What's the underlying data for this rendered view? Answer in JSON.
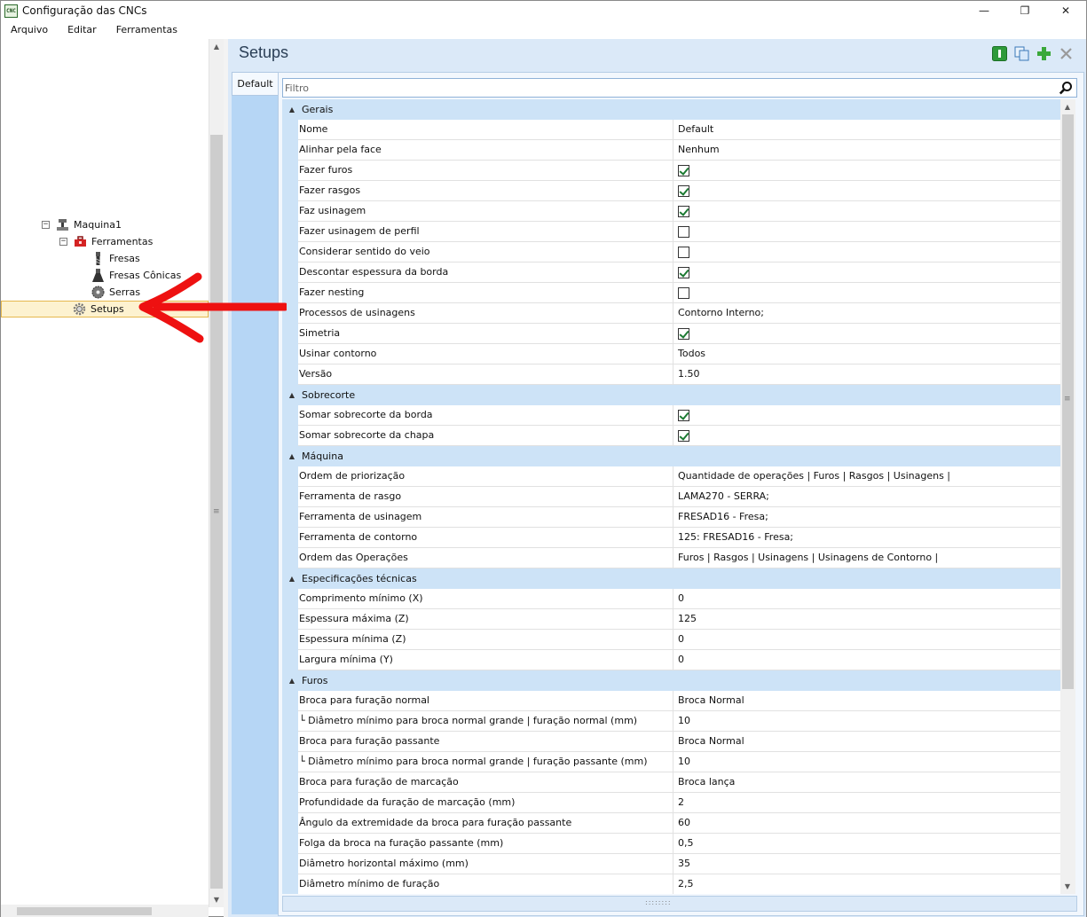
{
  "window": {
    "title": "Configuração das CNCs",
    "app_icon_text": "CNC",
    "min_glyph": "—",
    "max_glyph": "❐",
    "close_glyph": "✕"
  },
  "menu": {
    "items": [
      {
        "label": "Arquivo"
      },
      {
        "label": "Editar"
      },
      {
        "label": "Ferramentas"
      }
    ]
  },
  "tree": {
    "machine": {
      "label": "Maquina1",
      "expander": "−",
      "icon": "machine-icon"
    },
    "tools": {
      "label": "Ferramentas",
      "expander": "−",
      "icon": "toolbox-icon"
    },
    "fresas": {
      "label": "Fresas",
      "icon": "end-mill-icon"
    },
    "fresas_conicas": {
      "label": "Fresas Cônicas",
      "icon": "conical-mill-icon"
    },
    "serras": {
      "label": "Serras",
      "icon": "saw-blade-icon"
    },
    "setups": {
      "label": "Setups",
      "icon": "gear-icon",
      "selected": true
    }
  },
  "panel": {
    "title": "Setups",
    "toolbar": [
      "info-icon",
      "copy-icon",
      "add-icon",
      "delete-icon"
    ],
    "tab": "Default",
    "filter_placeholder": "Filtro",
    "filter_value": "",
    "accent_color": "#cde3f7",
    "selection_color": "#fdf2d0",
    "annotation_arrow_color": "#ee1111"
  },
  "categories": [
    {
      "name": "Gerais",
      "rows": [
        {
          "name": "Nome",
          "type": "text",
          "value": "Default"
        },
        {
          "name": "Alinhar pela face",
          "type": "text",
          "value": "Nenhum"
        },
        {
          "name": "Fazer furos",
          "type": "check",
          "value": true
        },
        {
          "name": "Fazer rasgos",
          "type": "check",
          "value": true
        },
        {
          "name": "Faz usinagem",
          "type": "check",
          "value": true
        },
        {
          "name": "Fazer usinagem de perfil",
          "type": "check",
          "value": false
        },
        {
          "name": "Considerar sentido do veio",
          "type": "check",
          "value": false
        },
        {
          "name": "Descontar espessura da borda",
          "type": "check",
          "value": true
        },
        {
          "name": "Fazer nesting",
          "type": "check",
          "value": false
        },
        {
          "name": "Processos de usinagens",
          "type": "text",
          "value": "Contorno Interno;"
        },
        {
          "name": "Simetria",
          "type": "check",
          "value": true
        },
        {
          "name": "Usinar contorno",
          "type": "text",
          "value": "Todos"
        },
        {
          "name": "Versão",
          "type": "text",
          "value": "1.50"
        }
      ]
    },
    {
      "name": "Sobrecorte",
      "rows": [
        {
          "name": "Somar sobrecorte da borda",
          "type": "check",
          "value": true
        },
        {
          "name": "Somar sobrecorte da chapa",
          "type": "check",
          "value": true
        }
      ]
    },
    {
      "name": "Máquina",
      "rows": [
        {
          "name": "Ordem de priorização",
          "type": "text",
          "value": "Quantidade de operações | Furos | Rasgos | Usinagens |"
        },
        {
          "name": "Ferramenta de rasgo",
          "type": "text",
          "value": "LAMA270 - SERRA;"
        },
        {
          "name": "Ferramenta de usinagem",
          "type": "text",
          "value": "FRESAD16 - Fresa;"
        },
        {
          "name": "Ferramenta de contorno",
          "type": "text",
          "value": "125: FRESAD16 - Fresa;"
        },
        {
          "name": "Ordem das Operações",
          "type": "text",
          "value": "Furos | Rasgos | Usinagens | Usinagens de Contorno |"
        }
      ]
    },
    {
      "name": "Especificações técnicas",
      "rows": [
        {
          "name": "Comprimento mínimo (X)",
          "type": "text",
          "value": "0"
        },
        {
          "name": "Espessura máxima (Z)",
          "type": "text",
          "value": "125"
        },
        {
          "name": "Espessura mínima (Z)",
          "type": "text",
          "value": "0"
        },
        {
          "name": "Largura mínima (Y)",
          "type": "text",
          "value": "0"
        }
      ]
    },
    {
      "name": "Furos",
      "rows": [
        {
          "name": "Broca para furação normal",
          "type": "text",
          "value": "Broca Normal"
        },
        {
          "name": "└ Diâmetro mínimo para broca normal grande | furação normal (mm)",
          "type": "text",
          "value": "10"
        },
        {
          "name": "Broca para furação passante",
          "type": "text",
          "value": "Broca Normal"
        },
        {
          "name": "└ Diâmetro mínimo para broca normal grande | furação passante (mm)",
          "type": "text",
          "value": "10"
        },
        {
          "name": "Broca para furação de marcação",
          "type": "text",
          "value": "Broca lança"
        },
        {
          "name": "Profundidade da furação de marcação (mm)",
          "type": "text",
          "value": "2"
        },
        {
          "name": "Ângulo da extremidade da broca para furação passante",
          "type": "text",
          "value": "60"
        },
        {
          "name": "Folga da broca na furação passante (mm)",
          "type": "text",
          "value": "0,5"
        },
        {
          "name": "Diâmetro horizontal máximo (mm)",
          "type": "text",
          "value": "35"
        },
        {
          "name": "Diâmetro mínimo de furação",
          "type": "text",
          "value": "2,5"
        }
      ]
    }
  ]
}
